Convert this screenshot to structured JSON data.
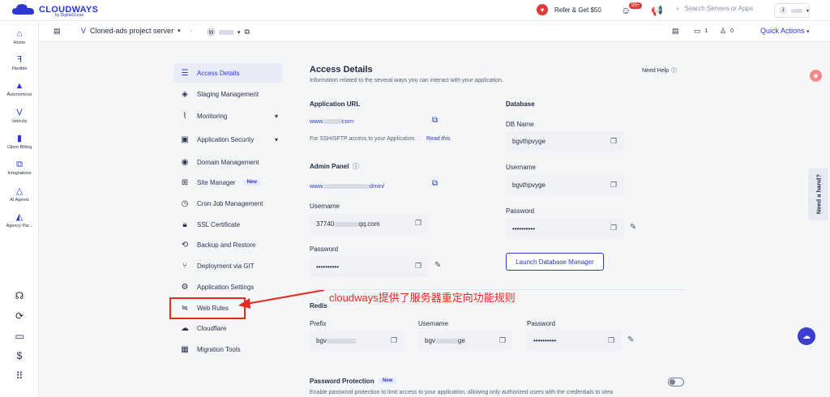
{
  "brand": {
    "name": "CLOUDWAYS",
    "sub": "by DigitalOcean"
  },
  "topbar": {
    "refer": "Refer & Get $50",
    "notif_badge": "99+",
    "search_placeholder": "Search Servers or Apps",
    "user_initial": "J"
  },
  "rail": {
    "items": [
      {
        "label": "Home",
        "icon": "home-icon"
      },
      {
        "label": "Flexible",
        "icon": "flexible-icon"
      },
      {
        "label": "Autonomous",
        "icon": "autonomous-icon"
      },
      {
        "label": "Velocity",
        "icon": "velocity-icon"
      },
      {
        "label": "Client Billing",
        "icon": "billing-icon"
      },
      {
        "label": "Integrations",
        "icon": "integrations-icon"
      },
      {
        "label": "AI Agents",
        "icon": "ai-agents-icon"
      },
      {
        "label": "Agency Par...",
        "icon": "agency-icon"
      }
    ]
  },
  "subbar": {
    "server": "Cloned-ads project server",
    "files_count": "1",
    "users_count": "0",
    "quick_actions": "Quick Actions"
  },
  "menu": [
    {
      "label": "Access Details",
      "active": true,
      "icon": "access-icon"
    },
    {
      "label": "Staging Management",
      "icon": "staging-icon"
    },
    {
      "label": "Monitoring",
      "icon": "monitoring-icon",
      "expandable": true
    },
    {
      "label": "Application Security",
      "icon": "security-icon",
      "expandable": true
    },
    {
      "label": "Domain Management",
      "icon": "domain-icon"
    },
    {
      "label": "Site Manager",
      "icon": "site-manager-icon",
      "badge": "New"
    },
    {
      "label": "Cron Job Management",
      "icon": "cron-icon"
    },
    {
      "label": "SSL Certificate",
      "icon": "ssl-icon"
    },
    {
      "label": "Backup and Restore",
      "icon": "backup-icon"
    },
    {
      "label": "Deployment via GIT",
      "icon": "git-icon"
    },
    {
      "label": "Application Settings",
      "icon": "settings-icon"
    },
    {
      "label": "Web Rules",
      "icon": "web-rules-icon"
    },
    {
      "label": "Cloudflare",
      "icon": "cloudflare-icon"
    },
    {
      "label": "Migration Tools",
      "icon": "migration-icon"
    }
  ],
  "main": {
    "title": "Access Details",
    "description": "Information related to the several ways you can interact with your application.",
    "need_help": "Need Help",
    "app_url": {
      "label": "Application URL",
      "url_start": "www.",
      "url_end": "com",
      "ssh_note": "For SSH/SFTP access to your Application.",
      "read_this": "Read this"
    },
    "admin_panel": {
      "label": "Admin Panel",
      "url_start": "www.",
      "url_end": "dmin/",
      "username_label": "Username",
      "username_start": "37740",
      "username_end": "qq.com",
      "password_label": "Password",
      "password": "••••••••••"
    },
    "database": {
      "label": "Database",
      "db_name_label": "DB Name",
      "db_name": "bgvthpvyge",
      "username_label": "Username",
      "username": "bgvthpvyge",
      "password_label": "Password",
      "password": "••••••••••",
      "launch": "Launch Database Manager"
    },
    "annotation": "cloudways提供了服务器重定向功能规则",
    "redis": {
      "label": "Redis",
      "prefix_label": "Prefix",
      "prefix": "bgv",
      "prefix_end": ":",
      "username_label": "Username",
      "username": "bgv",
      "username_end": "ge",
      "password_label": "Password",
      "password": "••••••••••"
    },
    "password_protection": {
      "label": "Password Protection",
      "badge": "New",
      "text": "Enable password protection to limit access to your application, allowing only authorized users with the credentials to view"
    }
  },
  "side_tab": "Need a hand?"
}
